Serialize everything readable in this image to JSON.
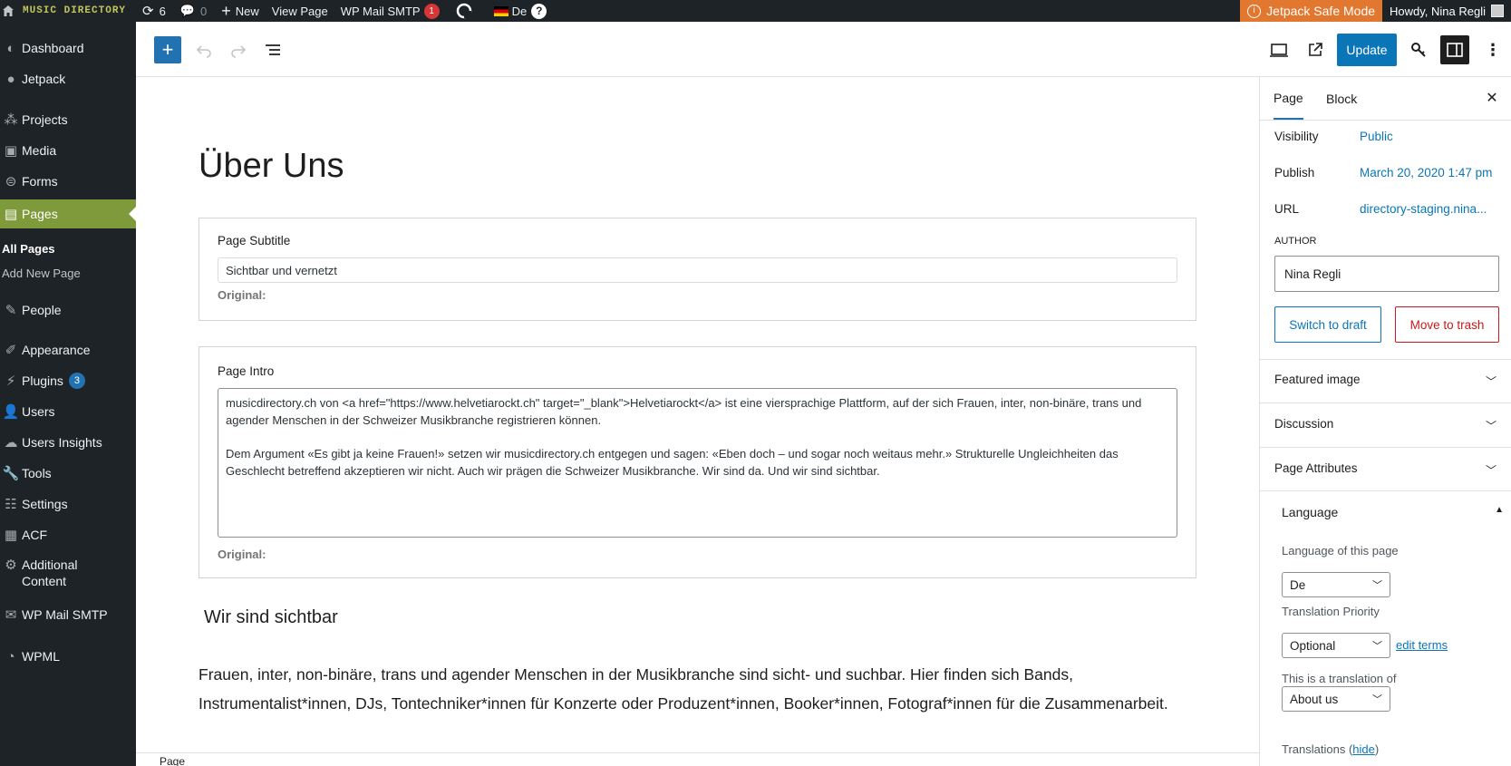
{
  "admin_bar": {
    "site_name": "MUSIC DIRECTORY",
    "updates_count": "6",
    "comments_count": "0",
    "new_label": "New",
    "view_page": "View Page",
    "wp_mail_smtp": "WP Mail SMTP",
    "wp_mail_badge": "1",
    "language": "De",
    "safe_mode": "Jetpack Safe Mode",
    "howdy": "Howdy, Nina Regli"
  },
  "sidebar": {
    "items": [
      {
        "label": "Dashboard",
        "icon": "dashboard-icon"
      },
      {
        "label": "Jetpack",
        "icon": "jetpack-icon"
      },
      {
        "label": "Projects",
        "icon": "projects-icon"
      },
      {
        "label": "Media",
        "icon": "media-icon"
      },
      {
        "label": "Forms",
        "icon": "forms-icon"
      },
      {
        "label": "Pages",
        "icon": "pages-icon"
      },
      {
        "label": "People",
        "icon": "pin-icon"
      },
      {
        "label": "Appearance",
        "icon": "brush-icon"
      },
      {
        "label": "Plugins",
        "icon": "plugins-icon",
        "badge": "3"
      },
      {
        "label": "Users",
        "icon": "users-icon"
      },
      {
        "label": "Users Insights",
        "icon": "insights-icon"
      },
      {
        "label": "Tools",
        "icon": "wrench-icon"
      },
      {
        "label": "Settings",
        "icon": "settings-icon"
      },
      {
        "label": "ACF",
        "icon": "acf-icon"
      },
      {
        "label": "Additional",
        "label2": "Content",
        "icon": "gear-icon"
      },
      {
        "label": "WP Mail SMTP",
        "icon": "mail-icon"
      },
      {
        "label": "WPML",
        "icon": "wpml-icon"
      }
    ],
    "sub_items": [
      "All Pages",
      "Add New Page"
    ]
  },
  "toolbar": {
    "update_label": "Update"
  },
  "editor": {
    "page_title": "Über Uns",
    "subtitle_field": {
      "label": "Page Subtitle",
      "value": "Sichtbar und vernetzt",
      "original": "Original:"
    },
    "intro_field": {
      "label": "Page Intro",
      "paragraph1": "musicdirectory.ch von <a href=\"https://www.helvetiarockt.ch\" target=\"_blank\">Helvetiarockt</a> ist eine viersprachige Plattform, auf der sich Frauen, inter, non-binäre, trans und agender Menschen in der Schweizer Musikbranche registrieren können.",
      "paragraph2": "Dem Argument «Es gibt ja keine Frauen!» setzen wir musicdirectory.ch entgegen und sagen: «Eben doch – und sogar noch weitaus mehr.» Strukturelle Ungleichheiten das Geschlecht betreffend akzeptieren wir nicht. Auch wir prägen die Schweizer Musikbranche. Wir sind da. Und wir sind sichtbar.",
      "original": "Original:"
    },
    "heading": "Wir sind sichtbar",
    "paragraph": "Frauen, inter, non-binäre, trans und agender Menschen in der Musikbranche sind sicht- und suchbar. Hier finden sich Bands, Instrumentalist*innen, DJs, Tontechniker*innen für Konzerte oder Produzent*innen, Booker*innen, Fotograf*innen für die Zusammenarbeit."
  },
  "footer": {
    "breadcrumb": "Page"
  },
  "panel": {
    "tabs": [
      "Page",
      "Block"
    ],
    "visibility_label": "Visibility",
    "visibility_value": "Public",
    "publish_label": "Publish",
    "publish_value": "March 20, 2020 1:47 pm",
    "url_label": "URL",
    "url_value": "directory-staging.nina...",
    "author_label": "AUTHOR",
    "author_value": "Nina Regli",
    "switch_draft": "Switch to draft",
    "move_trash": "Move to trash",
    "sections": [
      "Featured image",
      "Discussion",
      "Page Attributes"
    ],
    "language": {
      "title": "Language",
      "lang_label": "Language of this page",
      "lang_value": "De",
      "priority_label": "Translation Priority",
      "priority_value": "Optional",
      "edit_terms": "edit terms",
      "translation_of_label": "This is a translation of",
      "translation_of_value": "About us",
      "translations_label": "Translations (",
      "translations_hide": "hide",
      "translations_close": ")"
    }
  },
  "colors": {
    "admin_bg": "#1d2327",
    "active_menu": "#7e9a3a",
    "accent": "#0a76b8",
    "safe_mode": "#e27730",
    "danger": "#cc1818"
  }
}
